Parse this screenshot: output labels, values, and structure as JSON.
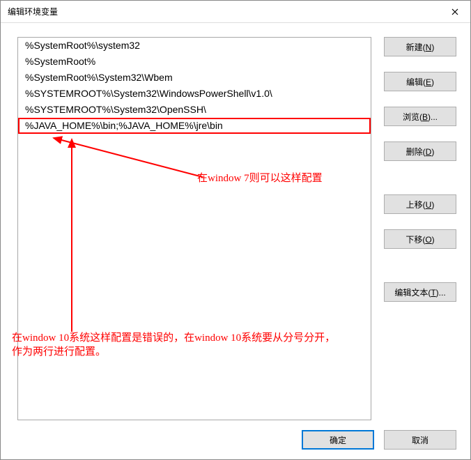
{
  "title": "编辑环境变量",
  "list": {
    "items": [
      "%SystemRoot%\\system32",
      "%SystemRoot%",
      "%SystemRoot%\\System32\\Wbem",
      "%SYSTEMROOT%\\System32\\WindowsPowerShell\\v1.0\\",
      "%SYSTEMROOT%\\System32\\OpenSSH\\",
      "%JAVA_HOME%\\bin;%JAVA_HOME%\\jre\\bin"
    ],
    "highlighted_index": 5
  },
  "buttons": {
    "new": "新建(N)",
    "edit": "编辑(E)",
    "browse": "浏览(B)...",
    "delete": "删除(D)",
    "move_up": "上移(U)",
    "move_down": "下移(O)",
    "edit_text": "编辑文本(T)...",
    "ok": "确定",
    "cancel": "取消"
  },
  "annotations": {
    "right": "在window 7则可以这样配置",
    "bottom_line1": "在window 10系统这样配置是错误的，在window 10系统要从分号分开，",
    "bottom_line2": "作为两行进行配置。"
  }
}
